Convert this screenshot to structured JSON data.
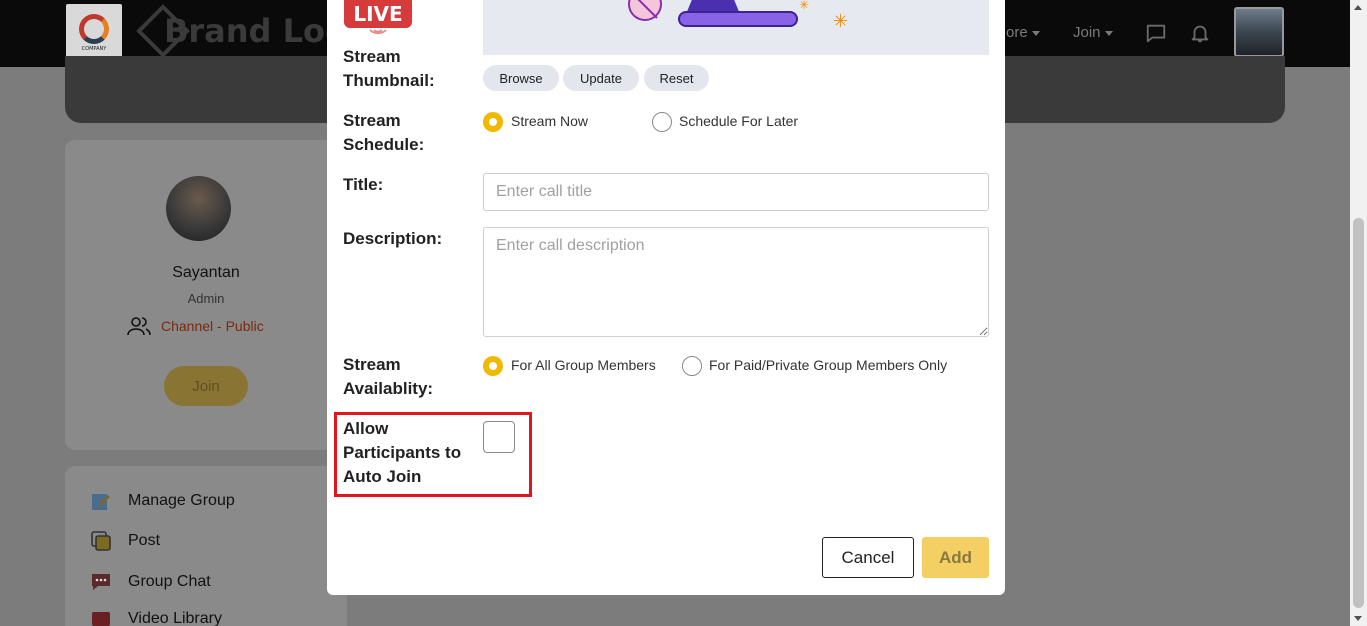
{
  "header": {
    "company_logo_text": "COMPANY",
    "brand_text": "Brand Log",
    "nav": {
      "more_label": "ore",
      "join_label": "Join"
    },
    "icons": {
      "chat": "chat-bubble-icon",
      "bell": "bell-icon"
    }
  },
  "sidebar": {
    "profile": {
      "name": "Sayantan",
      "role": "Admin",
      "channel_label": "Channel - Public",
      "join_label": "Join"
    },
    "menu": [
      {
        "label": "Manage Group",
        "icon": "edit-icon"
      },
      {
        "label": "Post",
        "icon": "post-icon"
      },
      {
        "label": "Group Chat",
        "icon": "chat-icon"
      },
      {
        "label": "Video Library",
        "icon": "video-icon"
      }
    ]
  },
  "modal": {
    "live_badge": "LIVE",
    "thumbnail": {
      "label": "Stream Thumbnail:",
      "buttons": {
        "browse": "Browse",
        "update": "Update",
        "reset": "Reset"
      }
    },
    "schedule": {
      "label": "Stream Schedule:",
      "options": [
        "Stream Now",
        "Schedule For Later"
      ],
      "selected": "Stream Now"
    },
    "title": {
      "label": "Title:",
      "placeholder": "Enter call title",
      "value": ""
    },
    "description": {
      "label": "Description:",
      "placeholder": "Enter call description",
      "value": ""
    },
    "availability": {
      "label": "Stream Availablity:",
      "options": [
        "For All Group Members",
        "For Paid/Private Group Members Only"
      ],
      "selected": "For All Group Members"
    },
    "auto_join": {
      "label": "Allow Participants to Auto Join",
      "checked": false
    },
    "actions": {
      "cancel": "Cancel",
      "add": "Add"
    }
  },
  "colors": {
    "accent": "#f1b800",
    "add_button": "#f4cf63",
    "highlight": "#e0151e",
    "live_red": "#d63a3a",
    "channel_text": "#c0451f"
  }
}
